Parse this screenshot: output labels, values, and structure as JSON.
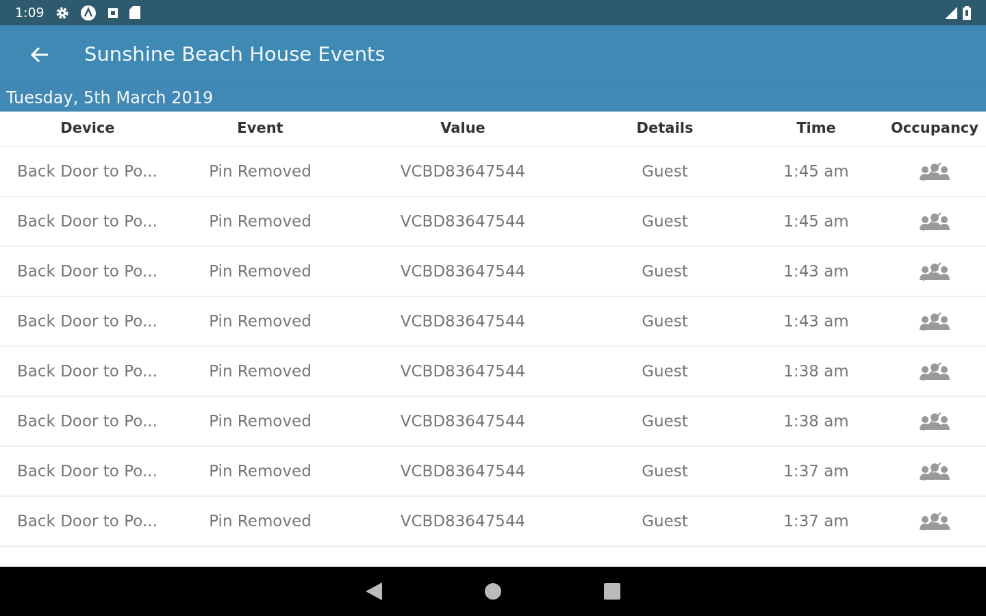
{
  "status_bar": {
    "time": "1:09"
  },
  "app_bar": {
    "title": "Sunshine Beach House Events"
  },
  "date": "Tuesday, 5th March 2019",
  "table": {
    "columns": [
      "Device",
      "Event",
      "Value",
      "Details",
      "Time",
      "Occupancy"
    ],
    "rows": [
      {
        "device": "Back Door to Po...",
        "event": "Pin Removed",
        "value": "VCBD83647544",
        "details": "Guest",
        "time": "1:45 am"
      },
      {
        "device": "Back Door to Po...",
        "event": "Pin Removed",
        "value": "VCBD83647544",
        "details": "Guest",
        "time": "1:45 am"
      },
      {
        "device": "Back Door to Po...",
        "event": "Pin Removed",
        "value": "VCBD83647544",
        "details": "Guest",
        "time": "1:43 am"
      },
      {
        "device": "Back Door to Po...",
        "event": "Pin Removed",
        "value": "VCBD83647544",
        "details": "Guest",
        "time": "1:43 am"
      },
      {
        "device": "Back Door to Po...",
        "event": "Pin Removed",
        "value": "VCBD83647544",
        "details": "Guest",
        "time": "1:38 am"
      },
      {
        "device": "Back Door to Po...",
        "event": "Pin Removed",
        "value": "VCBD83647544",
        "details": "Guest",
        "time": "1:38 am"
      },
      {
        "device": "Back Door to Po...",
        "event": "Pin Removed",
        "value": "VCBD83647544",
        "details": "Guest",
        "time": "1:37 am"
      },
      {
        "device": "Back Door to Po...",
        "event": "Pin Removed",
        "value": "VCBD83647544",
        "details": "Guest",
        "time": "1:37 am"
      }
    ]
  }
}
